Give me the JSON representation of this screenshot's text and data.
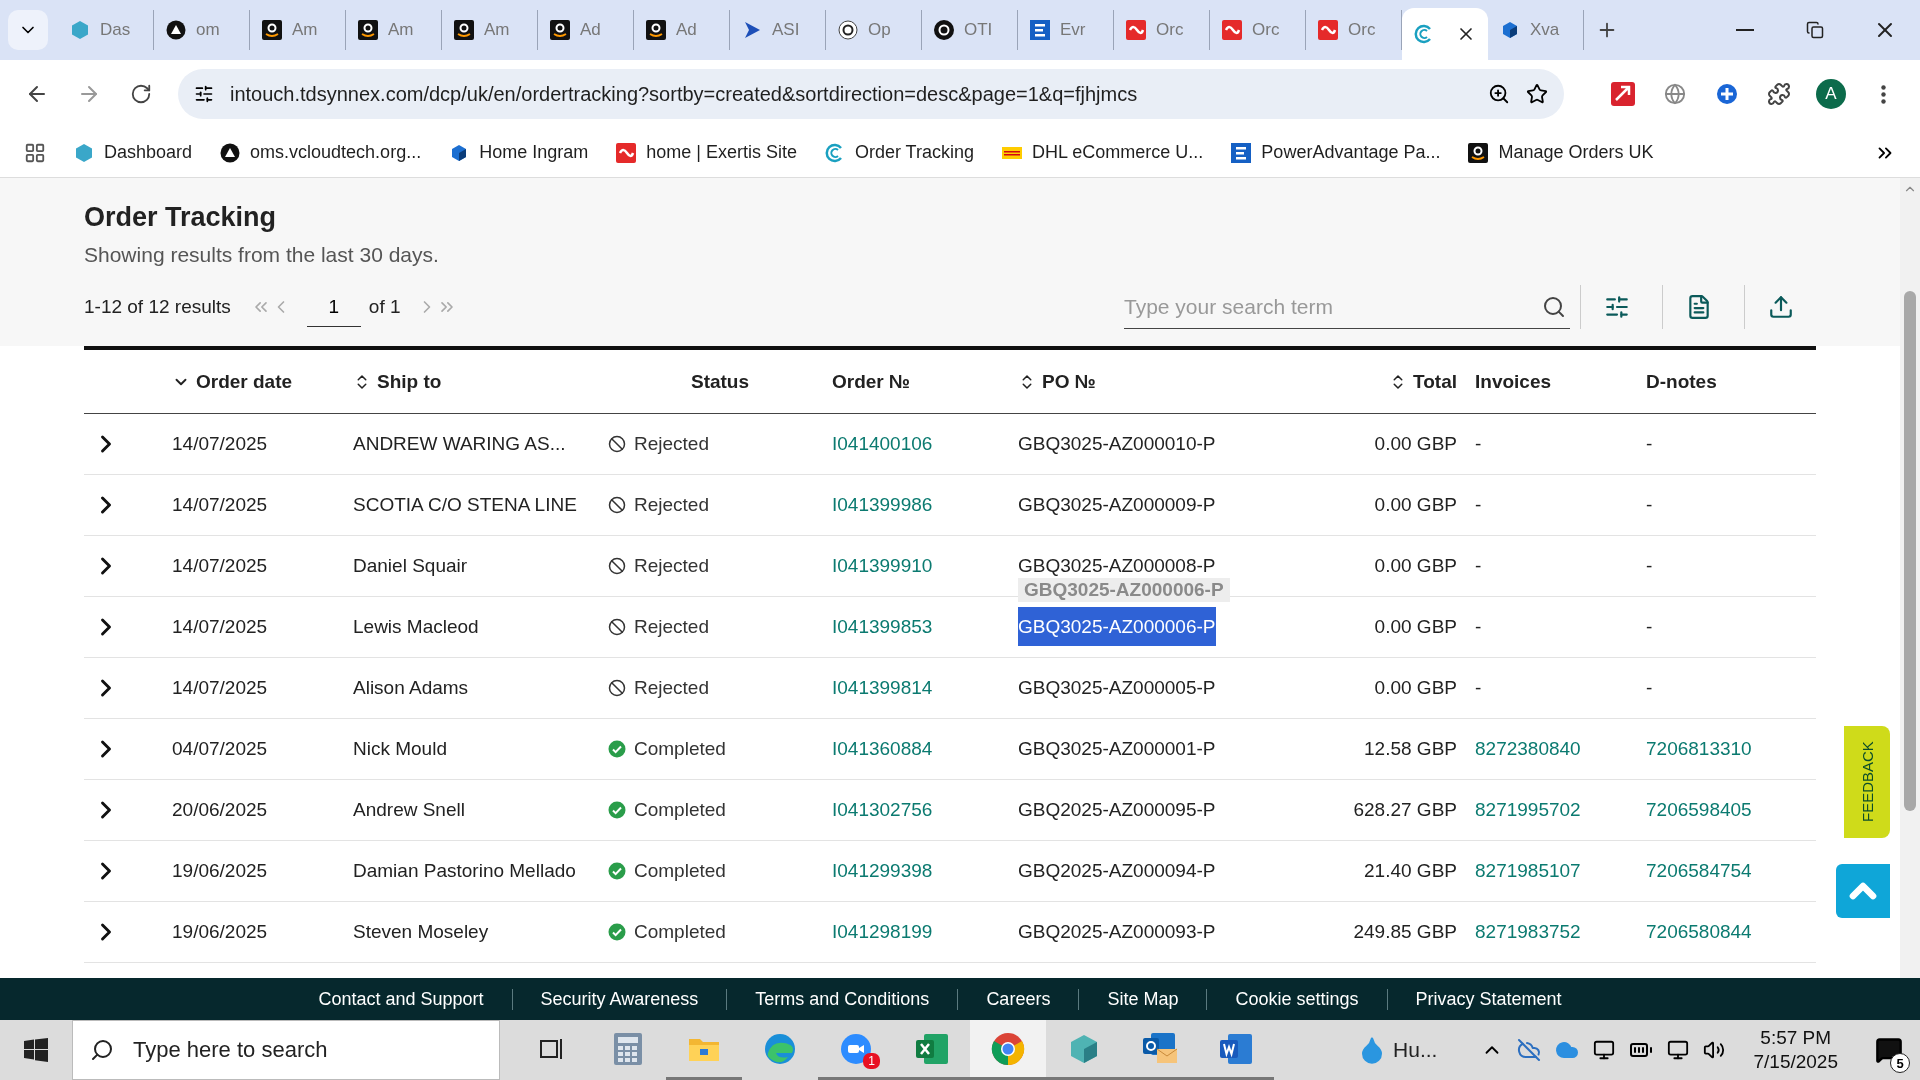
{
  "browser": {
    "tabs": [
      {
        "title": "Das",
        "kind": "hexagon",
        "selected": false
      },
      {
        "title": "om",
        "kind": "triangle",
        "selected": false
      },
      {
        "title": "Am",
        "kind": "smile",
        "selected": false
      },
      {
        "title": "Am",
        "kind": "smile",
        "selected": false
      },
      {
        "title": "Am",
        "kind": "smile",
        "selected": false
      },
      {
        "title": "Ad",
        "kind": "smile",
        "selected": false
      },
      {
        "title": "Ad",
        "kind": "smile",
        "selected": false
      },
      {
        "title": "ASI",
        "kind": "arrow",
        "selected": false
      },
      {
        "title": "Op",
        "kind": "knot",
        "selected": false
      },
      {
        "title": "OTI",
        "kind": "knotdark",
        "selected": false
      },
      {
        "title": "Evr",
        "kind": "bars",
        "selected": false
      },
      {
        "title": "Orc",
        "kind": "curve",
        "selected": false
      },
      {
        "title": "Orc",
        "kind": "curve",
        "selected": false
      },
      {
        "title": "Orc",
        "kind": "curve",
        "selected": false
      },
      {
        "kind": "ring",
        "selected": true
      },
      {
        "title": "Xva",
        "kind": "cube",
        "selected": false
      }
    ],
    "address": "intouch.tdsynnex.com/dcp/uk/en/ordertracking?sortby=created&sortdirection=desc&page=1&q=fjhjmcs",
    "profile": "A",
    "bookmarks": [
      {
        "label": "Dashboard",
        "kind": "hexagon"
      },
      {
        "label": "oms.vcloudtech.org...",
        "kind": "triangle"
      },
      {
        "label": "Home Ingram",
        "kind": "cube"
      },
      {
        "label": "home | Exertis Site",
        "kind": "curve"
      },
      {
        "label": "Order Tracking",
        "kind": "ring"
      },
      {
        "label": "DHL eCommerce U...",
        "kind": "stripes"
      },
      {
        "label": "PowerAdvantage Pa...",
        "kind": "bars"
      },
      {
        "label": "Manage Orders UK",
        "kind": "smile"
      }
    ]
  },
  "page": {
    "title": "Order Tracking",
    "subtitle": "Showing results from the last 30 days.",
    "results": "1-12 of 12 results",
    "page_value": "1",
    "page_total": "of 1",
    "search": {
      "placeholder": "Type your search term"
    }
  },
  "table": {
    "columns": [
      {
        "label": "Order date",
        "kind": "sorted"
      },
      {
        "label": "Ship to",
        "kind": "sortable"
      },
      {
        "label": "Status",
        "kind": "plain"
      },
      {
        "label": "Order №",
        "kind": "plain"
      },
      {
        "label": "PO №",
        "kind": "sortable"
      },
      {
        "label": "Total",
        "kind": "sortable"
      },
      {
        "label": "Invoices",
        "kind": "plain"
      },
      {
        "label": "D-notes",
        "kind": "plain"
      }
    ],
    "rows": [
      {
        "order_date": "14/07/2025",
        "ship_to": "ANDREW WARING AS...",
        "status": {
          "kind": "rejected",
          "label": "Rejected"
        },
        "order_no": "I041400106",
        "po_no": "GBQ3025-AZ000010-P",
        "po_highlighted": false,
        "total": "0.00 GBP",
        "invoice": {
          "text": "-",
          "link": false
        },
        "dnote": {
          "text": "-",
          "link": false
        }
      },
      {
        "order_date": "14/07/2025",
        "ship_to": "SCOTIA C/O STENA LINE",
        "status": {
          "kind": "rejected",
          "label": "Rejected"
        },
        "order_no": "I041399986",
        "po_no": "GBQ3025-AZ000009-P",
        "po_highlighted": false,
        "total": "0.00 GBP",
        "invoice": {
          "text": "-",
          "link": false
        },
        "dnote": {
          "text": "-",
          "link": false
        }
      },
      {
        "order_date": "14/07/2025",
        "ship_to": "Daniel Squair",
        "status": {
          "kind": "rejected",
          "label": "Rejected"
        },
        "order_no": "I041399910",
        "po_no": "GBQ3025-AZ000008-P",
        "po_highlighted": false,
        "drag_ghost": "GBQ3025-AZ000006-P",
        "total": "0.00 GBP",
        "invoice": {
          "text": "-",
          "link": false
        },
        "dnote": {
          "text": "-",
          "link": false
        }
      },
      {
        "order_date": "14/07/2025",
        "ship_to": "Lewis Macleod",
        "status": {
          "kind": "rejected",
          "label": "Rejected"
        },
        "order_no": "I041399853",
        "po_no": "GBQ3025-AZ000006-P",
        "po_highlighted": true,
        "total": "0.00 GBP",
        "invoice": {
          "text": "-",
          "link": false
        },
        "dnote": {
          "text": "-",
          "link": false
        }
      },
      {
        "order_date": "14/07/2025",
        "ship_to": "Alison Adams",
        "status": {
          "kind": "rejected",
          "label": "Rejected"
        },
        "order_no": "I041399814",
        "po_no": "GBQ3025-AZ000005-P",
        "po_highlighted": false,
        "total": "0.00 GBP",
        "invoice": {
          "text": "-",
          "link": false
        },
        "dnote": {
          "text": "-",
          "link": false
        }
      },
      {
        "order_date": "04/07/2025",
        "ship_to": "Nick Mould",
        "status": {
          "kind": "completed",
          "label": "Completed"
        },
        "order_no": "I041360884",
        "po_no": "GBQ3025-AZ000001-P",
        "po_highlighted": false,
        "total": "12.58 GBP",
        "invoice": {
          "text": "8272380840",
          "link": true
        },
        "dnote": {
          "text": "7206813310",
          "link": true
        }
      },
      {
        "order_date": "20/06/2025",
        "ship_to": "Andrew Snell",
        "status": {
          "kind": "completed",
          "label": "Completed"
        },
        "order_no": "I041302756",
        "po_no": "GBQ2025-AZ000095-P",
        "po_highlighted": false,
        "total": "628.27 GBP",
        "invoice": {
          "text": "8271995702",
          "link": true
        },
        "dnote": {
          "text": "7206598405",
          "link": true
        }
      },
      {
        "order_date": "19/06/2025",
        "ship_to": "Damian Pastorino Mellado",
        "status": {
          "kind": "completed",
          "label": "Completed"
        },
        "order_no": "I041299398",
        "po_no": "GBQ2025-AZ000094-P",
        "po_highlighted": false,
        "total": "21.40 GBP",
        "invoice": {
          "text": "8271985107",
          "link": true
        },
        "dnote": {
          "text": "7206584754",
          "link": true
        }
      },
      {
        "order_date": "19/06/2025",
        "ship_to": "Steven Moseley",
        "status": {
          "kind": "completed",
          "label": "Completed"
        },
        "order_no": "I041298199",
        "po_no": "GBQ2025-AZ000093-P",
        "po_highlighted": false,
        "total": "249.85 GBP",
        "invoice": {
          "text": "8271983752",
          "link": true
        },
        "dnote": {
          "text": "7206580844",
          "link": true
        }
      }
    ]
  },
  "feedback": "FEEDBACK",
  "footer": [
    "Contact and Support",
    "Security Awareness",
    "Terms and Conditions",
    "Careers",
    "Site Map",
    "Cookie settings",
    "Privacy Statement"
  ],
  "taskbar": {
    "search_placeholder": "Type here to search",
    "apps": [
      {
        "kind": "taskview",
        "running": false,
        "selected": false
      },
      {
        "kind": "calculator",
        "running": false,
        "selected": false
      },
      {
        "kind": "folder",
        "running": true,
        "selected": false
      },
      {
        "kind": "edge",
        "running": false,
        "selected": false
      },
      {
        "kind": "video",
        "running": true,
        "selected": false,
        "badge": "1"
      },
      {
        "kind": "sheet",
        "running": true,
        "selected": false
      },
      {
        "kind": "chrome",
        "running": true,
        "selected": true
      },
      {
        "kind": "gem",
        "running": true,
        "selected": false
      },
      {
        "kind": "mail",
        "running": true,
        "selected": false
      },
      {
        "kind": "doc",
        "running": true,
        "selected": false
      }
    ],
    "weather": "Hu...",
    "time": "5:57 PM",
    "date": "7/15/2025",
    "notifications": "5"
  }
}
